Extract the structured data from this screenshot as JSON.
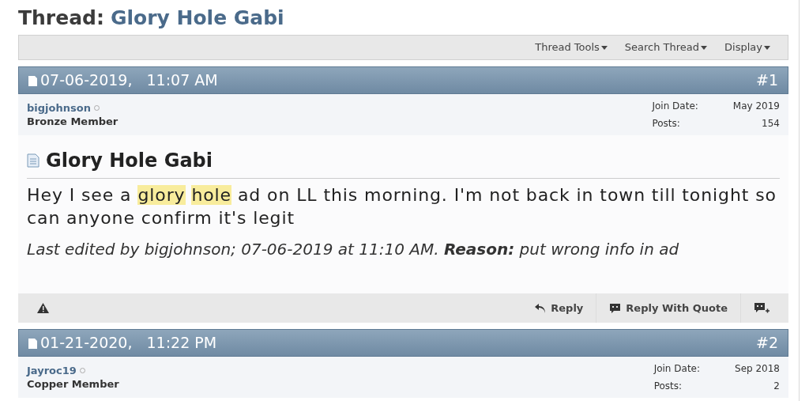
{
  "thread_label": "Thread:",
  "thread_title": "Glory Hole Gabi",
  "toolbar": [
    "Thread Tools",
    "Search Thread",
    "Display"
  ],
  "posts": [
    {
      "date": "07-06-2019,",
      "time": "11:07 AM",
      "number": "#1",
      "username": "bigjohnson",
      "rank": "Bronze Member",
      "join_label": "Join Date:",
      "join_date": "May 2019",
      "posts_label": "Posts:",
      "posts_count": "154",
      "title": "Glory Hole Gabi",
      "message": [
        {
          "text": "Hey I see a",
          "highlighted": false
        },
        {
          "text": "glory",
          "highlighted": true
        },
        {
          "text": "hole",
          "highlighted": true
        },
        {
          "text": "ad on LL this morning. I'm not back in town till tonight so can anyone confirm it's legit",
          "highlighted": false
        }
      ],
      "edit_note": "Last edited by bigjohnson; 07-06-2019 at 11:10 AM. **Reason:** put wrong info in ad",
      "actions": [
        "Reply",
        "Reply With Quote"
      ]
    },
    {
      "date": "01-21-2020,",
      "time": "11:22 PM",
      "number": "#2",
      "username": "Jayroc19",
      "rank": "Copper Member",
      "join_label": "Join Date:",
      "join_date": "Sep 2018",
      "posts_label": "Posts:",
      "posts_count": "2"
    }
  ]
}
